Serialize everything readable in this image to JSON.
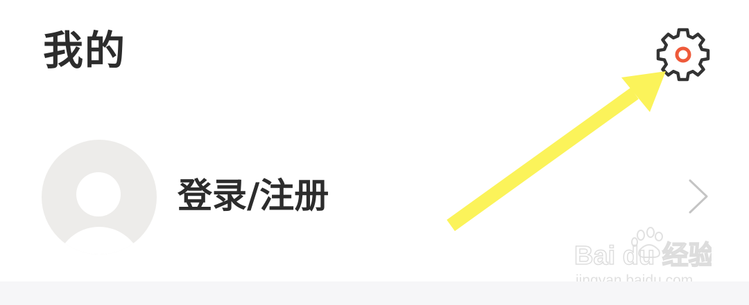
{
  "header": {
    "title": "我的",
    "settings_icon": "gear-icon",
    "accent_color": "#ee5a3a"
  },
  "profile": {
    "login_label": "登录/注册",
    "avatar_icon": "default-avatar",
    "chevron_icon": "chevron-right-icon"
  },
  "annotation": {
    "arrow_color": "#fbf35a",
    "arrow_icon": "arrow-up-right-icon"
  },
  "watermark": {
    "brand_text": "Bai du 经验",
    "url_text": "jingyan.baidu.com"
  }
}
